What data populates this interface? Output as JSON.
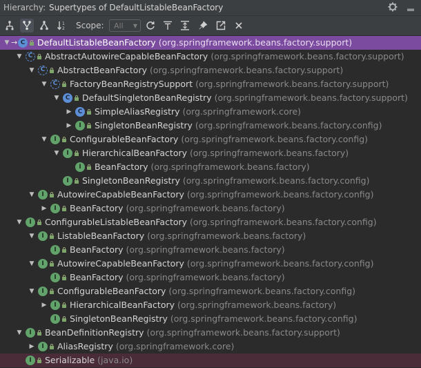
{
  "header": {
    "label": "Hierarchy:",
    "title": "Supertypes of DefaultListableBeanFactory"
  },
  "toolbar": {
    "scope_label": "Scope:",
    "scope_value": "All"
  },
  "colors": {
    "selected_row": "#7a4b9e",
    "class_icon": "#5d8fd6",
    "interface_icon": "#62a36b",
    "background": "#2b2b2b"
  },
  "tree": [
    {
      "name": "DefaultListableBeanFactory",
      "pkg": "(org.springframework.beans.factory.support)",
      "kind": "class",
      "expander": "down",
      "selected": true,
      "depth": 0
    },
    {
      "name": "AbstractAutowireCapableBeanFactory",
      "pkg": "(org.springframework.beans.factory.support)",
      "kind": "abstract",
      "expander": "down",
      "depth": 1
    },
    {
      "name": "AbstractBeanFactory",
      "pkg": "(org.springframework.beans.factory.support)",
      "kind": "abstract",
      "expander": "down",
      "depth": 2
    },
    {
      "name": "FactoryBeanRegistrySupport",
      "pkg": "(org.springframework.beans.factory.support)",
      "kind": "abstract",
      "expander": "down",
      "depth": 3
    },
    {
      "name": "DefaultSingletonBeanRegistry",
      "pkg": "(org.springframework.beans.factory.support)",
      "kind": "class",
      "expander": "down",
      "depth": 4
    },
    {
      "name": "SimpleAliasRegistry",
      "pkg": "(org.springframework.core)",
      "kind": "class",
      "expander": "right",
      "depth": 5
    },
    {
      "name": "SingletonBeanRegistry",
      "pkg": "(org.springframework.beans.factory.config)",
      "kind": "iface",
      "expander": "right",
      "depth": 5
    },
    {
      "name": "ConfigurableBeanFactory",
      "pkg": "(org.springframework.beans.factory.config)",
      "kind": "iface",
      "expander": "down",
      "depth": 3
    },
    {
      "name": "HierarchicalBeanFactory",
      "pkg": "(org.springframework.beans.factory)",
      "kind": "iface",
      "expander": "down",
      "depth": 4
    },
    {
      "name": "BeanFactory",
      "pkg": "(org.springframework.beans.factory)",
      "kind": "iface",
      "expander": "none",
      "depth": 5
    },
    {
      "name": "SingletonBeanRegistry",
      "pkg": "(org.springframework.beans.factory.config)",
      "kind": "iface",
      "expander": "none",
      "depth": 4
    },
    {
      "name": "AutowireCapableBeanFactory",
      "pkg": "(org.springframework.beans.factory.config)",
      "kind": "iface",
      "expander": "down",
      "depth": 2
    },
    {
      "name": "BeanFactory",
      "pkg": "(org.springframework.beans.factory)",
      "kind": "iface",
      "expander": "right",
      "depth": 3
    },
    {
      "name": "ConfigurableListableBeanFactory",
      "pkg": "(org.springframework.beans.factory.config)",
      "kind": "iface",
      "expander": "down",
      "depth": 1
    },
    {
      "name": "ListableBeanFactory",
      "pkg": "(org.springframework.beans.factory)",
      "kind": "iface",
      "expander": "down",
      "depth": 2
    },
    {
      "name": "BeanFactory",
      "pkg": "(org.springframework.beans.factory)",
      "kind": "iface",
      "expander": "none",
      "depth": 3
    },
    {
      "name": "AutowireCapableBeanFactory",
      "pkg": "(org.springframework.beans.factory.config)",
      "kind": "iface",
      "expander": "down",
      "depth": 2
    },
    {
      "name": "BeanFactory",
      "pkg": "(org.springframework.beans.factory)",
      "kind": "iface",
      "expander": "none",
      "depth": 3
    },
    {
      "name": "ConfigurableBeanFactory",
      "pkg": "(org.springframework.beans.factory.config)",
      "kind": "iface",
      "expander": "down",
      "depth": 2
    },
    {
      "name": "HierarchicalBeanFactory",
      "pkg": "(org.springframework.beans.factory)",
      "kind": "iface",
      "expander": "right",
      "depth": 3
    },
    {
      "name": "SingletonBeanRegistry",
      "pkg": "(org.springframework.beans.factory.config)",
      "kind": "iface",
      "expander": "none",
      "depth": 3
    },
    {
      "name": "BeanDefinitionRegistry",
      "pkg": "(org.springframework.beans.factory.support)",
      "kind": "iface",
      "expander": "down",
      "depth": 1
    },
    {
      "name": "AliasRegistry",
      "pkg": "(org.springframework.core)",
      "kind": "iface",
      "expander": "right",
      "depth": 2
    },
    {
      "name": "Serializable",
      "pkg": "(java.io)",
      "kind": "iface",
      "expander": "none",
      "depth": 1,
      "highlight": "pink"
    }
  ]
}
